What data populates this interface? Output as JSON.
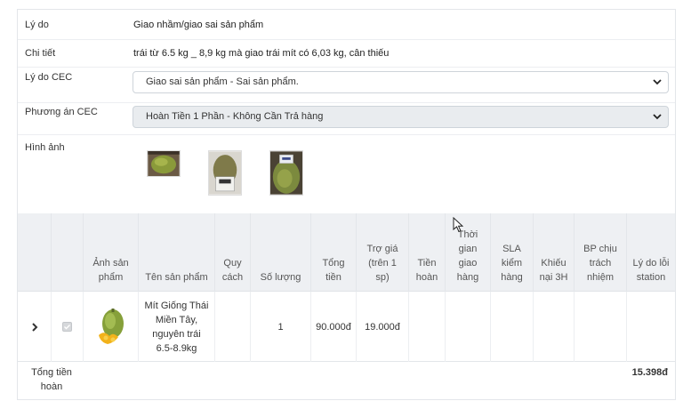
{
  "reason": {
    "label": "Lý do",
    "value": "Giao nhầm/giao sai sản phẩm"
  },
  "detail": {
    "label": "Chi tiết",
    "value": "trái từ 6.5 kg _ 8,9 kg mà giao trái mít có 6,03 kg, cân thiếu"
  },
  "cec_reason": {
    "label": "Lý do CEC",
    "selected": "Giao sai sản phẩm - Sai sản phẩm."
  },
  "cec_plan": {
    "label": "Phương án CEC",
    "selected": "Hoàn Tiền 1 Phần - Không Cần Trả hàng"
  },
  "images": {
    "label": "Hình ảnh"
  },
  "table": {
    "headers": {
      "image": "Ảnh sản phẩm",
      "name": "Tên sản phẩm",
      "spec": "Quy cách",
      "qty": "Số lượng",
      "total": "Tổng tiền",
      "subsidy": "Trợ giá (trên 1 sp)",
      "refund": "Tiền hoàn",
      "delivery_time": "Thời gian giao hàng",
      "sla": "SLA kiểm hàng",
      "complaint": "Khiếu nại 3H",
      "dept": "BP chịu trách nhiệm",
      "station_error": "Lý do lỗi station"
    },
    "row": {
      "name": "Mít Giống Thái Miền Tây, nguyên trái 6.5-8.9kg",
      "spec": "",
      "qty": "1",
      "total": "90.000đ",
      "subsidy": "19.000đ",
      "refund": "",
      "delivery_time": "",
      "sla": "",
      "complaint": "",
      "dept": "",
      "station_error": ""
    }
  },
  "summary": {
    "label": "Tổng tiền hoàn",
    "value": "15.398đ"
  },
  "colors": {
    "header_bg": "#eef0f3",
    "border": "#e3e6ea",
    "select_grey": "#e9ecef"
  }
}
